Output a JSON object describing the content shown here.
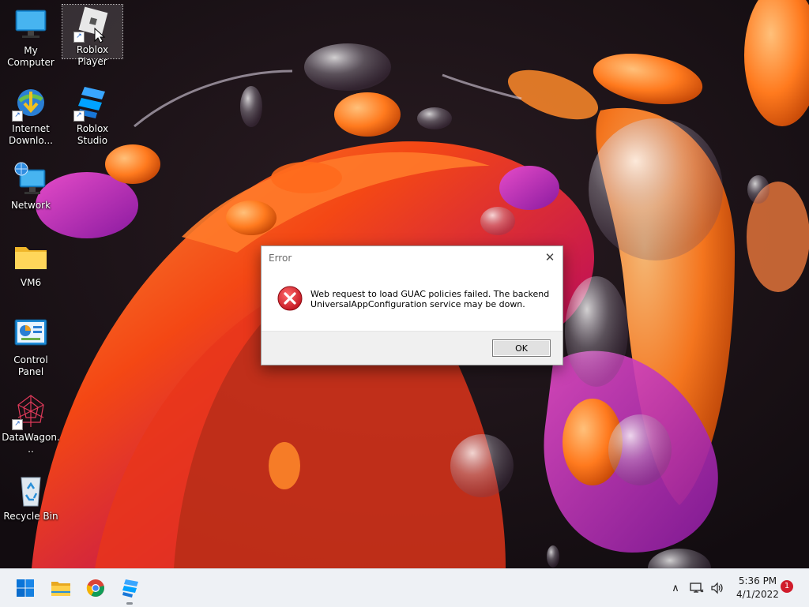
{
  "desktop": {
    "icons": [
      {
        "label": "My Computer",
        "icon": "computer-icon"
      },
      {
        "label": "Roblox Player",
        "icon": "roblox-player-icon",
        "selected": true
      },
      {
        "label": "Internet Downlo...",
        "icon": "internet-download-manager-icon"
      },
      {
        "label": "Roblox Studio",
        "icon": "roblox-studio-icon"
      },
      {
        "label": "Network",
        "icon": "network-icon"
      },
      {
        "label": "VM6",
        "icon": "folder-icon"
      },
      {
        "label": "Control Panel",
        "icon": "control-panel-icon"
      },
      {
        "label": "DataWagon...",
        "icon": "datawagon-icon"
      },
      {
        "label": "Recycle Bin",
        "icon": "recycle-bin-icon"
      }
    ]
  },
  "dialog": {
    "title": "Error",
    "close_symbol": "✕",
    "message": "Web request to load GUAC policies failed. The backend UniversalAppConfiguration service may be down.",
    "ok_label": "OK",
    "icon": "error-icon"
  },
  "taskbar": {
    "pinned": [
      {
        "name": "start",
        "icon": "windows-start-icon"
      },
      {
        "name": "file-explorer",
        "icon": "file-explorer-icon"
      },
      {
        "name": "chrome",
        "icon": "chrome-icon"
      },
      {
        "name": "roblox-studio",
        "icon": "roblox-studio-icon"
      }
    ],
    "tray": {
      "chevron_symbol": "∧",
      "time": "5:36 PM",
      "date": "4/1/2022",
      "notification_count": "1"
    }
  },
  "colors": {
    "accent": "#0067c0",
    "error_red": "#d01c2b",
    "taskbar_bg": "#eef1f5",
    "dialog_footer": "#f0f0f0"
  }
}
